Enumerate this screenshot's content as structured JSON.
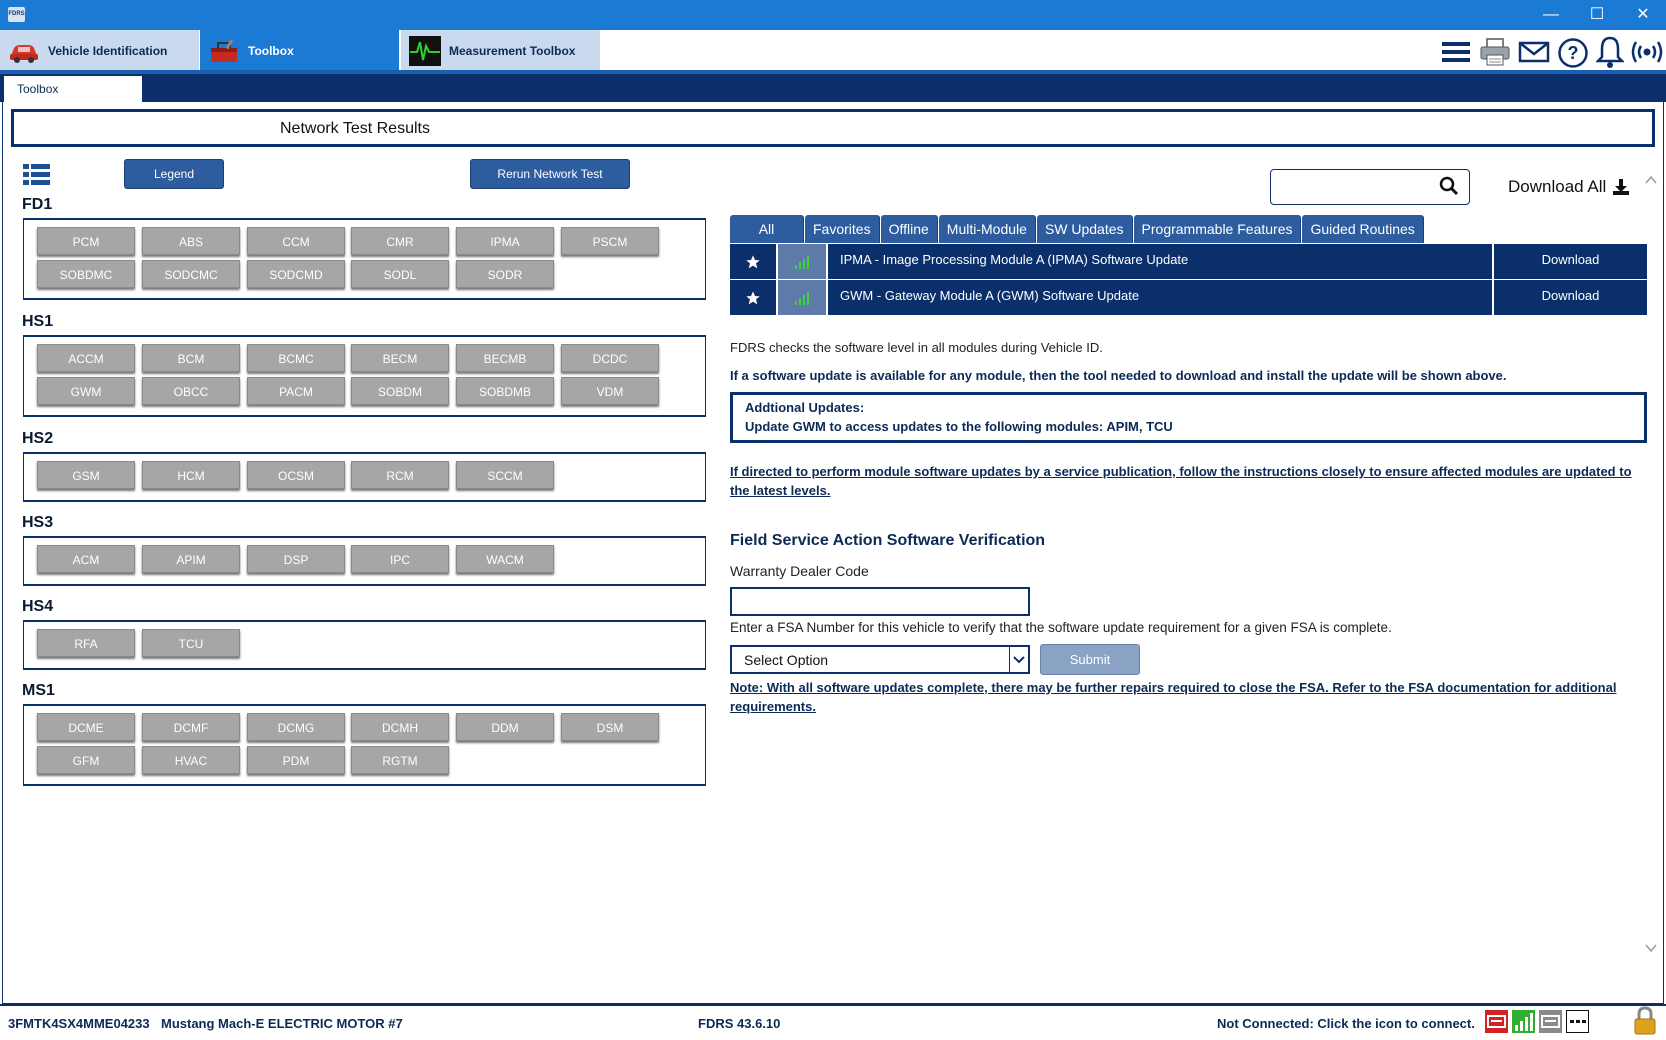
{
  "window": {
    "app_icon_text": "FDRS",
    "minimize": "—",
    "maximize": "☐",
    "close": "✕"
  },
  "app_tabs": [
    {
      "label": "Vehicle Identification",
      "icon": "car-icon"
    },
    {
      "label": "Toolbox",
      "icon": "toolbox-icon"
    },
    {
      "label": "Measurement Toolbox",
      "icon": "oscilloscope-icon"
    }
  ],
  "toolbar_icons": [
    "menu-icon",
    "print-icon",
    "mail-icon",
    "help-icon",
    "bell-icon",
    "wireless-icon"
  ],
  "subtab": {
    "label": "Toolbox"
  },
  "header": {
    "title": "Network Test Results"
  },
  "buttons": {
    "legend": "Legend",
    "rerun": "Rerun Network Test"
  },
  "networks": [
    {
      "name": "FD1",
      "rows": [
        [
          "PCM",
          "ABS",
          "CCM",
          "CMR",
          "IPMA",
          "PSCM"
        ],
        [
          "SOBDMC",
          "SODCMC",
          "SODCMD",
          "SODL",
          "SODR"
        ]
      ]
    },
    {
      "name": "HS1",
      "rows": [
        [
          "ACCM",
          "BCM",
          "BCMC",
          "BECM",
          "BECMB",
          "DCDC"
        ],
        [
          "GWM",
          "OBCC",
          "PACM",
          "SOBDM",
          "SOBDMB",
          "VDM"
        ]
      ]
    },
    {
      "name": "HS2",
      "rows": [
        [
          "GSM",
          "HCM",
          "OCSM",
          "RCM",
          "SCCM"
        ]
      ]
    },
    {
      "name": "HS3",
      "rows": [
        [
          "ACM",
          "APIM",
          "DSP",
          "IPC",
          "WACM"
        ]
      ]
    },
    {
      "name": "HS4",
      "rows": [
        [
          "RFA",
          "TCU"
        ]
      ]
    },
    {
      "name": "MS1",
      "rows": [
        [
          "DCME",
          "DCMF",
          "DCMG",
          "DCMH",
          "DDM",
          "DSM"
        ],
        [
          "GFM",
          "HVAC",
          "PDM",
          "RGTM"
        ]
      ]
    }
  ],
  "search": {
    "placeholder": ""
  },
  "download_all": "Download All",
  "filter_tabs": [
    "All",
    "Favorites",
    "Offline",
    "Multi-Module",
    "SW Updates",
    "Programmable Features",
    "Guided Routines"
  ],
  "updates": [
    {
      "name": "IPMA - Image Processing Module A (IPMA) Software Update",
      "action": "Download"
    },
    {
      "name": "GWM - Gateway Module A (GWM) Software Update",
      "action": "Download"
    }
  ],
  "info": {
    "line1": "FDRS checks the software level in all modules during Vehicle ID.",
    "line2": "If a software update is available for any module, then the tool needed to download and install the update will be shown above.",
    "additional_title": "Addtional Updates:",
    "additional_body": "Update GWM to access updates to the following modules: APIM, TCU",
    "service_link": "If directed to perform module software updates by a service publication, follow the instructions closely to ensure affected modules are updated to the latest levels."
  },
  "fsa": {
    "title": "Field Service Action Software Verification",
    "dealer_label": "Warranty Dealer Code",
    "dealer_value": "",
    "instructions": "Enter a FSA Number for this vehicle to verify that the software update requirement for a given FSA is complete.",
    "select_value": "Select Option",
    "submit": "Submit",
    "note": "Note: With all software updates complete, there may be further repairs required to close the FSA. Refer to the FSA documentation for additional requirements."
  },
  "status": {
    "vin": "3FMTK4SX4MME04233",
    "vehicle": "Mustang Mach-E ELECTRIC MOTOR #7",
    "version": "FDRS 43.6.10",
    "connection": "Not Connected: Click the icon to connect."
  },
  "colors": {
    "accent": "#0b2f6b",
    "button": "#2d5d9f",
    "module_gray": "#a6a6a6",
    "titlebar": "#1a7ad4"
  }
}
